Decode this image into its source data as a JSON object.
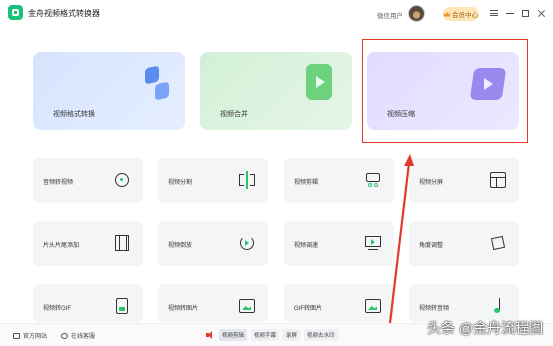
{
  "window": {
    "title": "金舟视频格式转换器",
    "user_label": "微信用户",
    "member_button": "会员中心"
  },
  "feature_cards": [
    {
      "label": "视频格式转换",
      "color": "#5b8cf0"
    },
    {
      "label": "视频合并",
      "color": "#6cd27c"
    },
    {
      "label": "视频压缩",
      "color": "#9b88ef"
    }
  ],
  "tools": [
    {
      "label": "音频转视频",
      "icon": "music-disc-icon"
    },
    {
      "label": "视频分割",
      "icon": "split-icon"
    },
    {
      "label": "视频剪辑",
      "icon": "scissor-icon"
    },
    {
      "label": "视频分屏",
      "icon": "grid-icon"
    },
    {
      "label": "片头片尾添加",
      "icon": "film-icon"
    },
    {
      "label": "视频倒放",
      "icon": "rotate-icon"
    },
    {
      "label": "视频调速",
      "icon": "monitor-play-icon"
    },
    {
      "label": "角度调整",
      "icon": "angle-icon"
    },
    {
      "label": "视频转GIF",
      "icon": "gif-doc-icon"
    },
    {
      "label": "视频转图片",
      "icon": "image-icon"
    },
    {
      "label": "GIF转图片",
      "icon": "image-icon"
    },
    {
      "label": "视频转音频",
      "icon": "music-note-icon"
    }
  ],
  "footer": {
    "website": "官方网站",
    "support": "在线客服",
    "chips": [
      "视频剪辑",
      "视频字幕",
      "录屏",
      "视频去水印"
    ]
  },
  "watermark": "头条 @金舟流程图",
  "colors": {
    "accent_green": "#2ac46b",
    "highlight_red": "#e23b2e"
  }
}
